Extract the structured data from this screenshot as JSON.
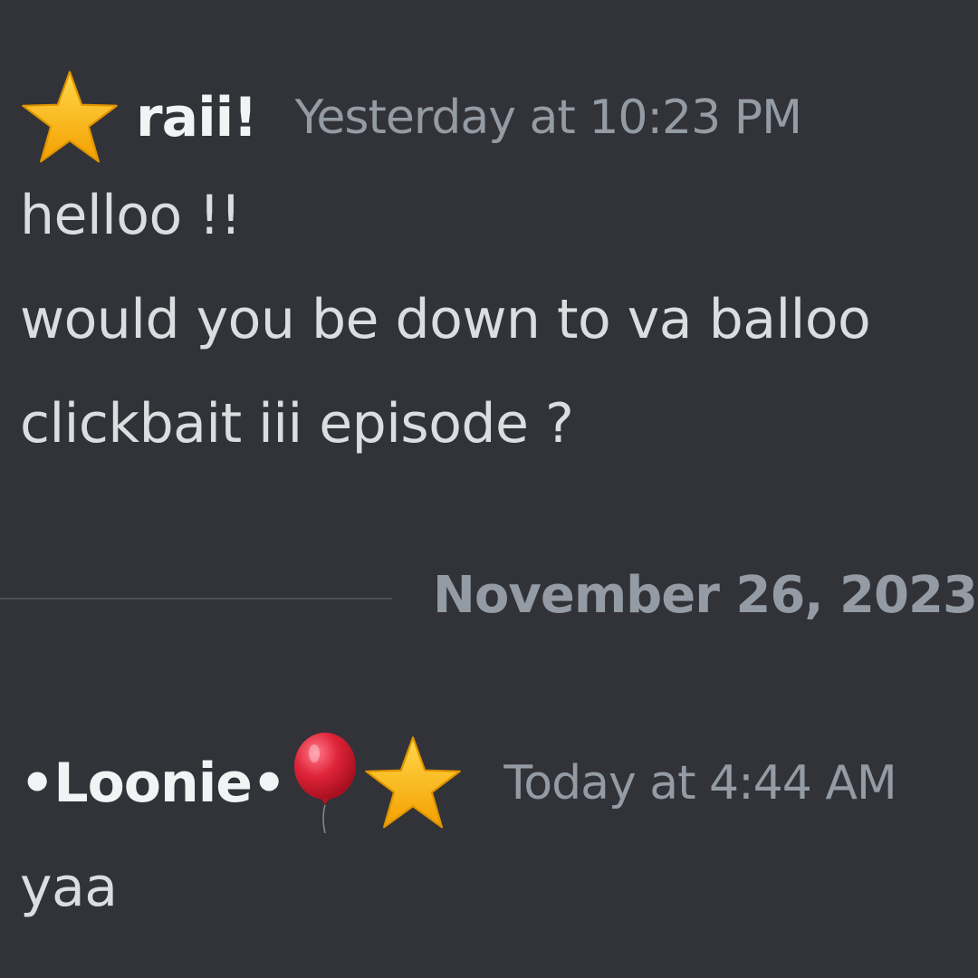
{
  "messages": [
    {
      "username": "raii!",
      "timestamp": "Yesterday at 10:23 PM",
      "lines": [
        "helloo !!",
        "would you be down to va balloo",
        "clickbait iii episode ?"
      ]
    },
    {
      "username": "•Loonie•",
      "timestamp": "Today at 4:44 AM",
      "lines": [
        "yaa"
      ]
    }
  ],
  "divider": {
    "date": "November 26, 2023"
  },
  "icons": {
    "star": "star-icon",
    "balloon": "balloon-icon"
  },
  "colors": {
    "background": "#313338",
    "username": "#f2f3f5",
    "message_text": "#dbdee1",
    "timestamp": "#949ba4",
    "divider_line": "#4e5058",
    "star": "#fcc21b",
    "balloon": "#dd2e44"
  }
}
